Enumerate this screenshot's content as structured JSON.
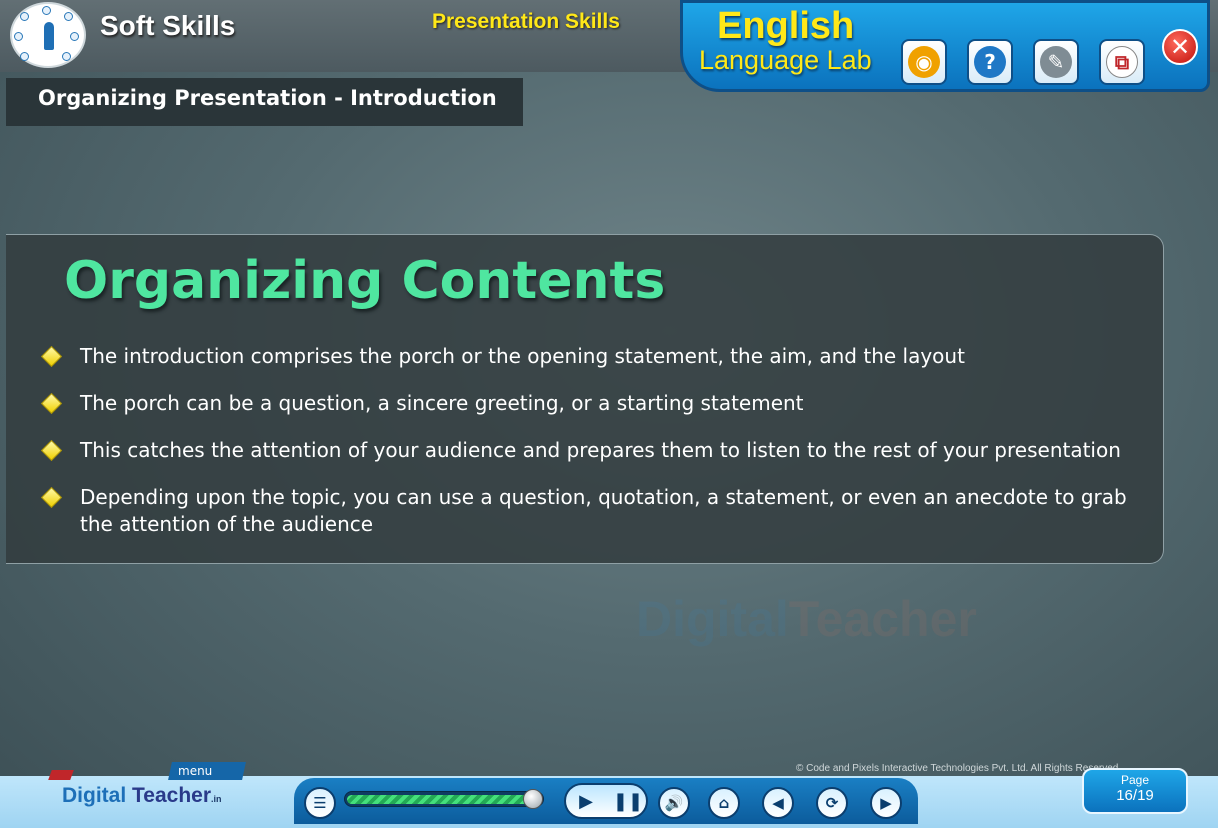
{
  "header": {
    "app_title": "Soft Skills",
    "module_title": "Presentation Skills",
    "brand_line1": "English",
    "brand_line2": "Language Lab",
    "tools": [
      {
        "icon": "camera-icon",
        "color": "#f0a100",
        "glyph": "◉"
      },
      {
        "icon": "help-icon",
        "color": "#1f78c6",
        "glyph": "?"
      },
      {
        "icon": "book-icon",
        "color": "#7f8c94",
        "glyph": "✎"
      },
      {
        "icon": "window-icon",
        "color": "#ffffff",
        "glyph": "⧉"
      }
    ],
    "close_glyph": "✕"
  },
  "section": {
    "label": "Organizing Presentation - Introduction"
  },
  "slide": {
    "heading": "Organizing Contents",
    "bullets": [
      "The introduction comprises the porch or the opening statement, the aim, and the layout",
      "The porch can be a question, a sincere greeting, or a starting statement",
      "This catches the attention of your audience and prepares them to listen to the rest of your presentation",
      "Depending upon the topic, you can use a question, quotation, a statement, or even an anecdote to grab the attention of the audience"
    ]
  },
  "watermark": {
    "part1": "Digital",
    "part2": "Teacher"
  },
  "footer": {
    "copyright": "© Code and Pixels Interactive Technologies  Pvt. Ltd. All Rights Reserved.",
    "menu_label": "menu",
    "brand_part1": "Digital",
    "brand_part2": "Teacher",
    "brand_suffix": ".in",
    "progress_fraction": 0.97,
    "page_label": "Page",
    "page_value": "16/19",
    "accent_color": "#1a7fc4"
  }
}
